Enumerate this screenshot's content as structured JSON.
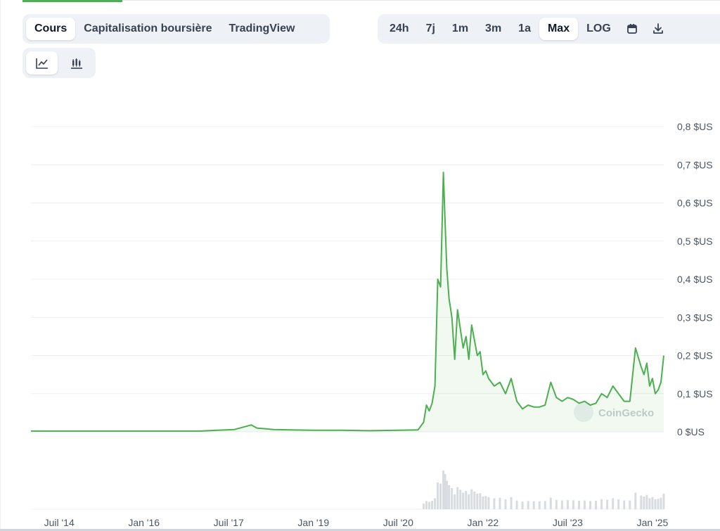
{
  "tabs": {
    "metric": [
      {
        "label": "Cours",
        "active": true
      },
      {
        "label": "Capitalisation boursière",
        "active": false
      },
      {
        "label": "TradingView",
        "active": false
      }
    ],
    "range": [
      {
        "label": "24h",
        "active": false
      },
      {
        "label": "7j",
        "active": false
      },
      {
        "label": "1m",
        "active": false
      },
      {
        "label": "3m",
        "active": false
      },
      {
        "label": "1a",
        "active": false
      },
      {
        "label": "Max",
        "active": true
      },
      {
        "label": "LOG",
        "active": false
      }
    ],
    "icons": [
      "calendar-icon",
      "download-icon"
    ]
  },
  "view_toggle": [
    "line-chart-icon",
    "candlestick-chart-icon"
  ],
  "watermark": "CoinGecko",
  "colors": {
    "line": "#4caf50",
    "area": "#4caf50",
    "grid": "#eceff3",
    "volume": "#d8dbe0"
  },
  "chart_data": {
    "type": "line",
    "x_ticks": [
      "Juil '14",
      "Jan '16",
      "Juil '17",
      "Jan '19",
      "Juil '20",
      "Jan '22",
      "Juil '23",
      "Jan '25"
    ],
    "y_ticks": [
      "0 $US",
      "0,1 $US",
      "0,2 $US",
      "0,3 $US",
      "0,4 $US",
      "0,5 $US",
      "0,6 $US",
      "0,7 $US",
      "0,8 $US"
    ],
    "ylim": [
      0,
      0.8
    ],
    "xlim": [
      2014.0,
      2025.2
    ],
    "grid": true,
    "series": [
      {
        "x": [
          2014.0,
          2015.0,
          2016.0,
          2017.0,
          2017.3,
          2017.6,
          2017.9,
          2018.0,
          2018.3,
          2018.6,
          2019.0,
          2019.5,
          2020.0,
          2020.5,
          2020.85,
          2020.95,
          2021.0,
          2021.05,
          2021.1,
          2021.15,
          2021.2,
          2021.25,
          2021.3,
          2021.33,
          2021.36,
          2021.4,
          2021.45,
          2021.5,
          2021.55,
          2021.6,
          2021.65,
          2021.7,
          2021.75,
          2021.8,
          2021.85,
          2021.9,
          2021.95,
          2022.0,
          2022.05,
          2022.1,
          2022.2,
          2022.3,
          2022.4,
          2022.5,
          2022.6,
          2022.7,
          2022.8,
          2022.9,
          2023.0,
          2023.1,
          2023.2,
          2023.3,
          2023.4,
          2023.5,
          2023.6,
          2023.7,
          2023.8,
          2023.9,
          2024.0,
          2024.1,
          2024.2,
          2024.3,
          2024.4,
          2024.5,
          2024.6,
          2024.7,
          2024.8,
          2024.85,
          2024.9,
          2024.95,
          2025.0,
          2025.05,
          2025.1,
          2025.15,
          2025.2
        ],
        "y": [
          0.002,
          0.002,
          0.002,
          0.002,
          0.004,
          0.006,
          0.018,
          0.01,
          0.006,
          0.005,
          0.004,
          0.004,
          0.003,
          0.004,
          0.005,
          0.025,
          0.07,
          0.055,
          0.075,
          0.12,
          0.4,
          0.38,
          0.68,
          0.55,
          0.43,
          0.35,
          0.3,
          0.19,
          0.32,
          0.27,
          0.22,
          0.25,
          0.19,
          0.28,
          0.24,
          0.2,
          0.21,
          0.15,
          0.16,
          0.14,
          0.12,
          0.13,
          0.1,
          0.14,
          0.08,
          0.06,
          0.07,
          0.065,
          0.065,
          0.07,
          0.13,
          0.09,
          0.08,
          0.09,
          0.085,
          0.075,
          0.08,
          0.07,
          0.075,
          0.1,
          0.09,
          0.12,
          0.1,
          0.08,
          0.08,
          0.22,
          0.17,
          0.15,
          0.18,
          0.12,
          0.14,
          0.1,
          0.11,
          0.13,
          0.2
        ]
      }
    ]
  }
}
